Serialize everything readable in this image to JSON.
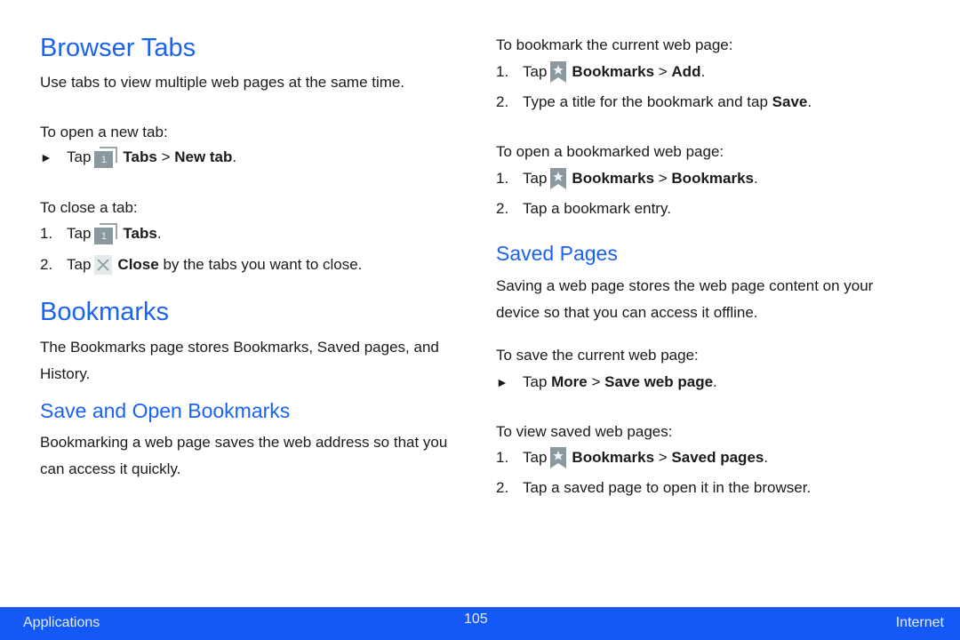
{
  "left": {
    "browser_tabs": {
      "title": "Browser Tabs",
      "intro": "Use tabs to view multiple web pages at the same time.",
      "open_tab_label": "To open a new tab:",
      "open_tab_step": {
        "tap": "Tap",
        "icon": "tabs-icon",
        "icon_text": "1",
        "b1": "Tabs",
        "sep": " > ",
        "b2": "New tab",
        "end": "."
      },
      "close_tab_label": "To close a tab:",
      "close_steps": [
        {
          "num": "1.",
          "tap": "Tap",
          "icon": "tabs-icon",
          "icon_text": "1",
          "b1": "Tabs",
          "end": "."
        },
        {
          "num": "2.",
          "tap": "Tap",
          "icon": "close-icon",
          "b1": "Close",
          "end": " by the tabs you want to close."
        }
      ]
    },
    "bookmarks": {
      "title": "Bookmarks",
      "intro": "The Bookmarks page stores Bookmarks, Saved pages, and History."
    },
    "save_open": {
      "title": "Save and Open Bookmarks",
      "intro": "Bookmarking a web page saves the web address so that you can access it quickly."
    }
  },
  "right": {
    "bookmark_current_label": "To bookmark the current web page:",
    "bookmark_steps": [
      {
        "num": "1.",
        "tap": "Tap",
        "icon": "bookmark-icon",
        "b1": "Bookmarks",
        "sep": " > ",
        "b2": "Add",
        "end": "."
      },
      {
        "num": "2.",
        "text": "Type a title for the bookmark and tap ",
        "b1": "Save",
        "end": "."
      }
    ],
    "open_bookmarked_label": "To open a bookmarked web page:",
    "open_steps": [
      {
        "num": "1.",
        "tap": "Tap",
        "icon": "bookmark-icon",
        "b1": "Bookmarks",
        "sep": " > ",
        "b2": "Bookmarks",
        "end": "."
      },
      {
        "num": "2.",
        "text": "Tap a bookmark entry."
      }
    ],
    "saved_pages": {
      "title": "Saved Pages",
      "intro": "Saving a web page stores the web page content on your device so that you can access it offline.",
      "save_current_label": "To save the current web page:",
      "save_step": {
        "tap": "Tap ",
        "b1": "More",
        "sep": " > ",
        "b2": "Save web page",
        "end": "."
      },
      "view_label": "To view saved web pages:",
      "view_steps": [
        {
          "num": "1.",
          "tap": "Tap",
          "icon": "bookmark-icon",
          "b1": "Bookmarks",
          "sep": " > ",
          "b2": "Saved pages",
          "end": "."
        },
        {
          "num": "2.",
          "text": "Tap a saved page to open it in the browser."
        }
      ]
    }
  },
  "footer": {
    "left": "Applications",
    "page_number": "105",
    "right": "Internet",
    "color": "#1459f5"
  },
  "colors": {
    "heading": "#1a62f0",
    "icon_gray": "#8a999d"
  }
}
